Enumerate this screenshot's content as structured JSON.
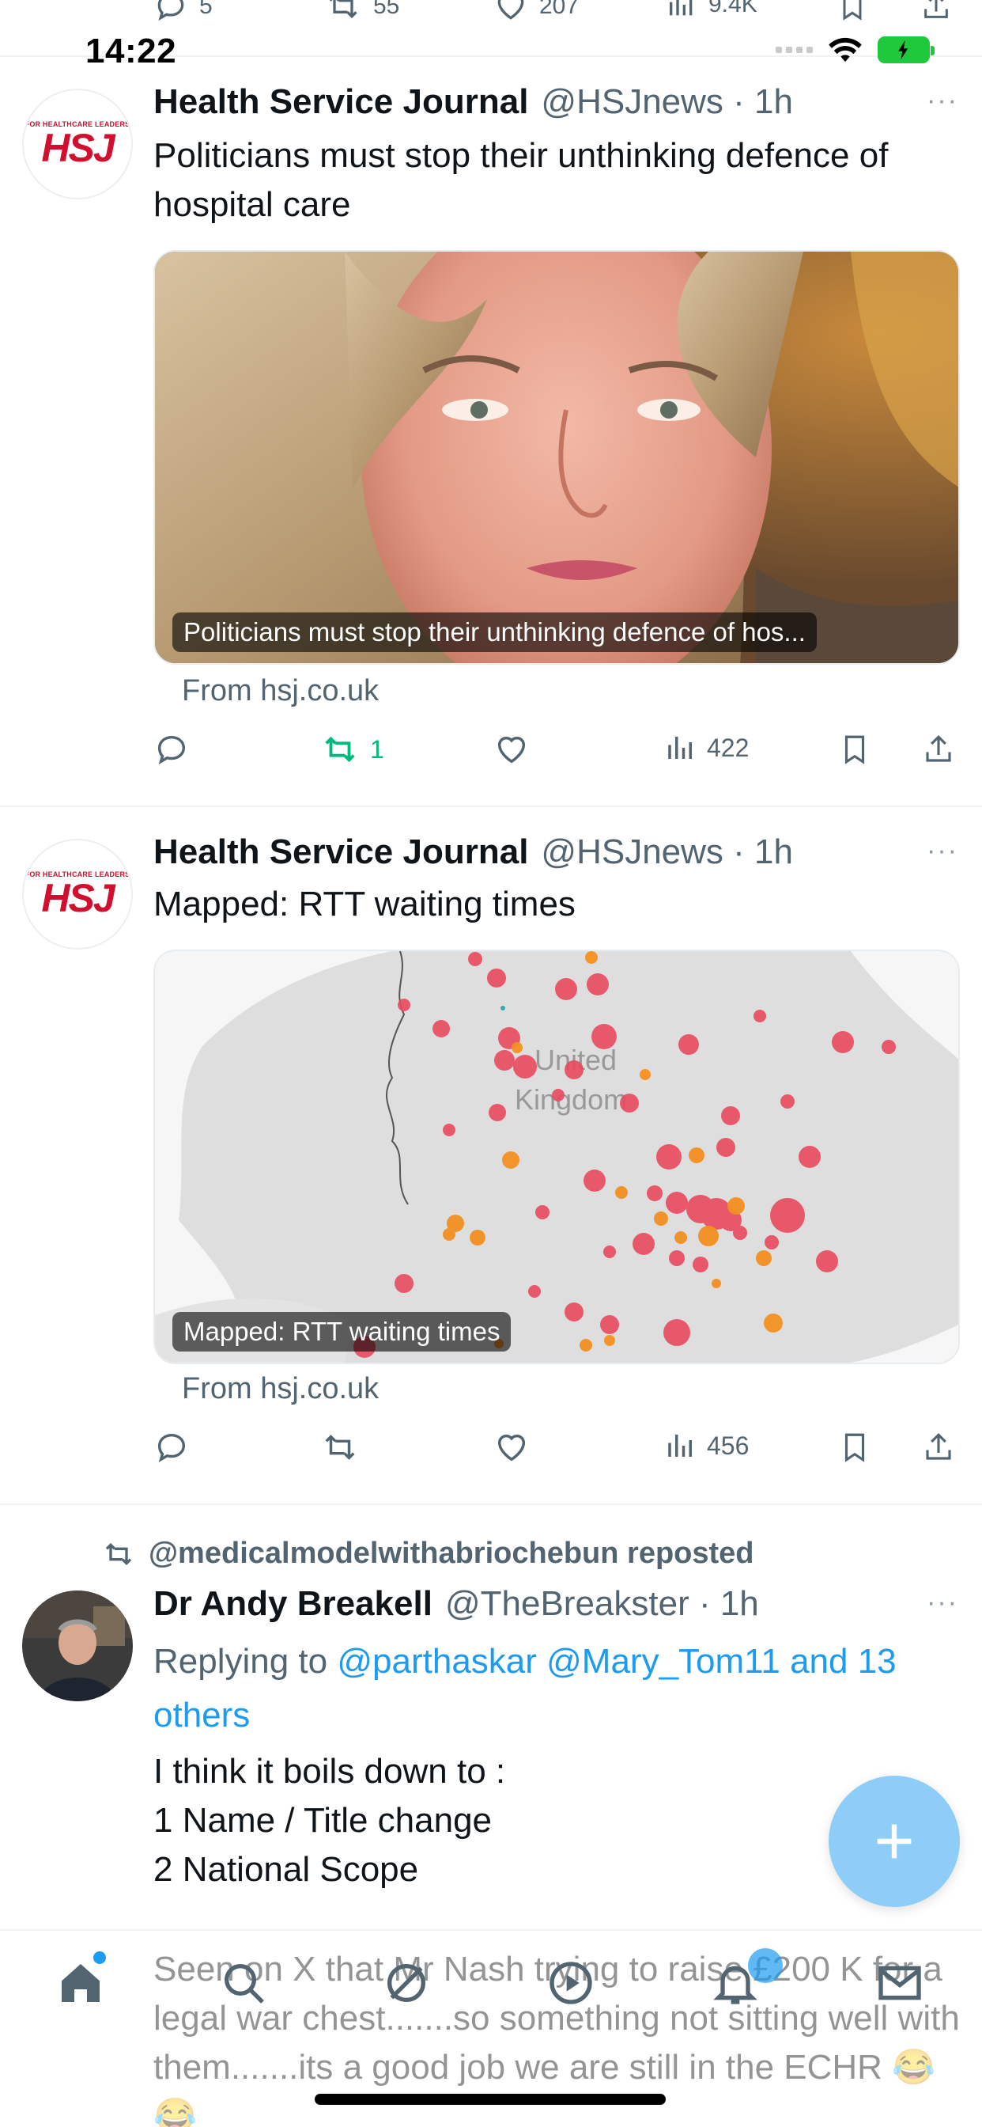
{
  "status_bar": {
    "time": "14:22"
  },
  "prev_tweet_actions": {
    "replies": "5",
    "reposts": "55",
    "likes": "207",
    "views": "9.4K"
  },
  "tweets": [
    {
      "author": "Health Service Journal",
      "handle": "@HSJnews · 1h",
      "avatar_text_small": "FOR HEALTHCARE LEADERS",
      "avatar_text_big": "HSJ",
      "text": "Politicians must stop their unthinking defence of hospital care",
      "card_caption": "Politicians must stop their unthinking defence of hos...",
      "card_source": "From hsj.co.uk",
      "replies": "",
      "reposts": "1",
      "likes": "",
      "views": "422"
    },
    {
      "author": "Health Service Journal",
      "handle": "@HSJnews · 1h",
      "avatar_text_small": "FOR HEALTHCARE LEADERS",
      "avatar_text_big": "HSJ",
      "text": "Mapped: RTT waiting times",
      "card_caption": "Mapped: RTT waiting times",
      "map_label_line1": "United",
      "map_label_line2": "Kingdom",
      "card_source": "From hsj.co.uk",
      "replies": "",
      "reposts": "",
      "likes": "",
      "views": "456"
    },
    {
      "repost_by": "@medicalmodelwithabriochebun reposted",
      "author": "Dr Andy Breakell",
      "handle": "@TheBreakster · 1h",
      "reply_prefix": "Replying to ",
      "reply_users": "@parthaskar @Mary_Tom11 and 13 others",
      "text_lines": [
        "I think it boils down to :",
        "1 Name / Title change",
        "2 National Scope"
      ],
      "faded_text": "Seen on X that Mr Nash trying to raise £200 K for a legal war chest.......so something not sitting well with them.......its a good job we are still in the ECHR 😂😂"
    }
  ],
  "more_label": "···",
  "nav": {
    "home": "home-icon",
    "search": "search-icon",
    "grok": "grok-icon",
    "video": "video-icon",
    "notifications": "bell-icon",
    "messages": "mail-icon"
  },
  "colors": {
    "accent": "#1d9bf0",
    "repost_green": "#00ba7c",
    "muted": "#536471",
    "hsj_red": "#d0102e",
    "fab": "#8ecdf8"
  }
}
